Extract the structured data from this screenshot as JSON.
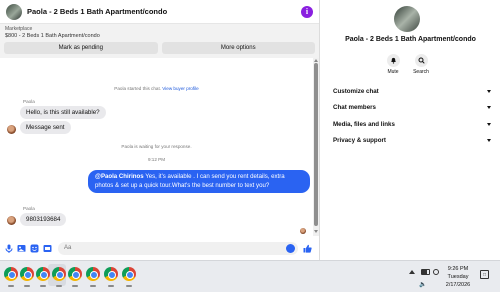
{
  "header": {
    "title": "Paola - 2 Beds 1 Bath Apartment/condo",
    "info_icon": "info-icon"
  },
  "marketplace": {
    "label": "Marketplace",
    "listing": "$800 - 2 Beds 1 Bath Apartment/condo",
    "mark_pending": "Mark as pending",
    "more_options": "More options"
  },
  "messages": {
    "started_text": "Paola started this chat.",
    "buyer_profile_link": "View buyer profile",
    "sender1": "Paola",
    "incoming1": "Hello, is this still available?",
    "incoming2": "Message sent",
    "waiting_text": "Paola is waiting for your response.",
    "time": "9:12 PM",
    "outgoing_mention": "@Paola Chirinos",
    "outgoing_text": " Yes, it's available .  I can send you rent details, extra photos & set up a quick tour.What's the best number to text you?",
    "sender2": "Paola",
    "incoming3": "9803193684"
  },
  "composer": {
    "placeholder": "Aa"
  },
  "details": {
    "title": "Paola - 2 Beds 1 Bath Apartment/condo",
    "mute_label": "Mute",
    "search_label": "Search",
    "sections": [
      "Customize chat",
      "Chat members",
      "Media, files and links",
      "Privacy & support"
    ]
  },
  "taskbar": {
    "time": "9:26 PM",
    "day": "Tuesday",
    "date": "2/17/2026"
  },
  "colors": {
    "accent": "#2a63f2",
    "info": "#8a1fe0",
    "bubble_in": "#e9e9ec"
  }
}
